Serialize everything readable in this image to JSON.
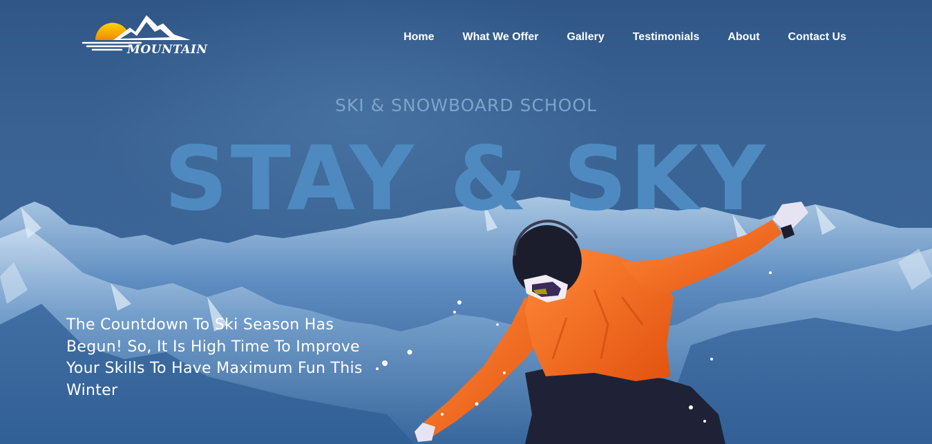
{
  "brand": {
    "logo_text": "MOUNTAIN"
  },
  "nav": {
    "items": [
      {
        "label": "Home"
      },
      {
        "label": "What We Offer"
      },
      {
        "label": "Gallery"
      },
      {
        "label": "Testimonials"
      },
      {
        "label": "About"
      },
      {
        "label": "Contact Us"
      }
    ]
  },
  "hero": {
    "subtitle": "SKI & SNOWBOARD SCHOOL",
    "headline": "STAY & SKY",
    "tagline": "The Countdown To Ski Season Has Begun! So, It Is High Time To Improve Your Skills To Have Maximum Fun This Winter"
  },
  "colors": {
    "sky": "#34598a",
    "headline": "#4e8ac0",
    "subtitle": "#7fa4cb",
    "jacket": "#f26a1f",
    "sun": "#f6a800"
  },
  "icons": {
    "logo": "mountain-sun-logo-icon"
  }
}
